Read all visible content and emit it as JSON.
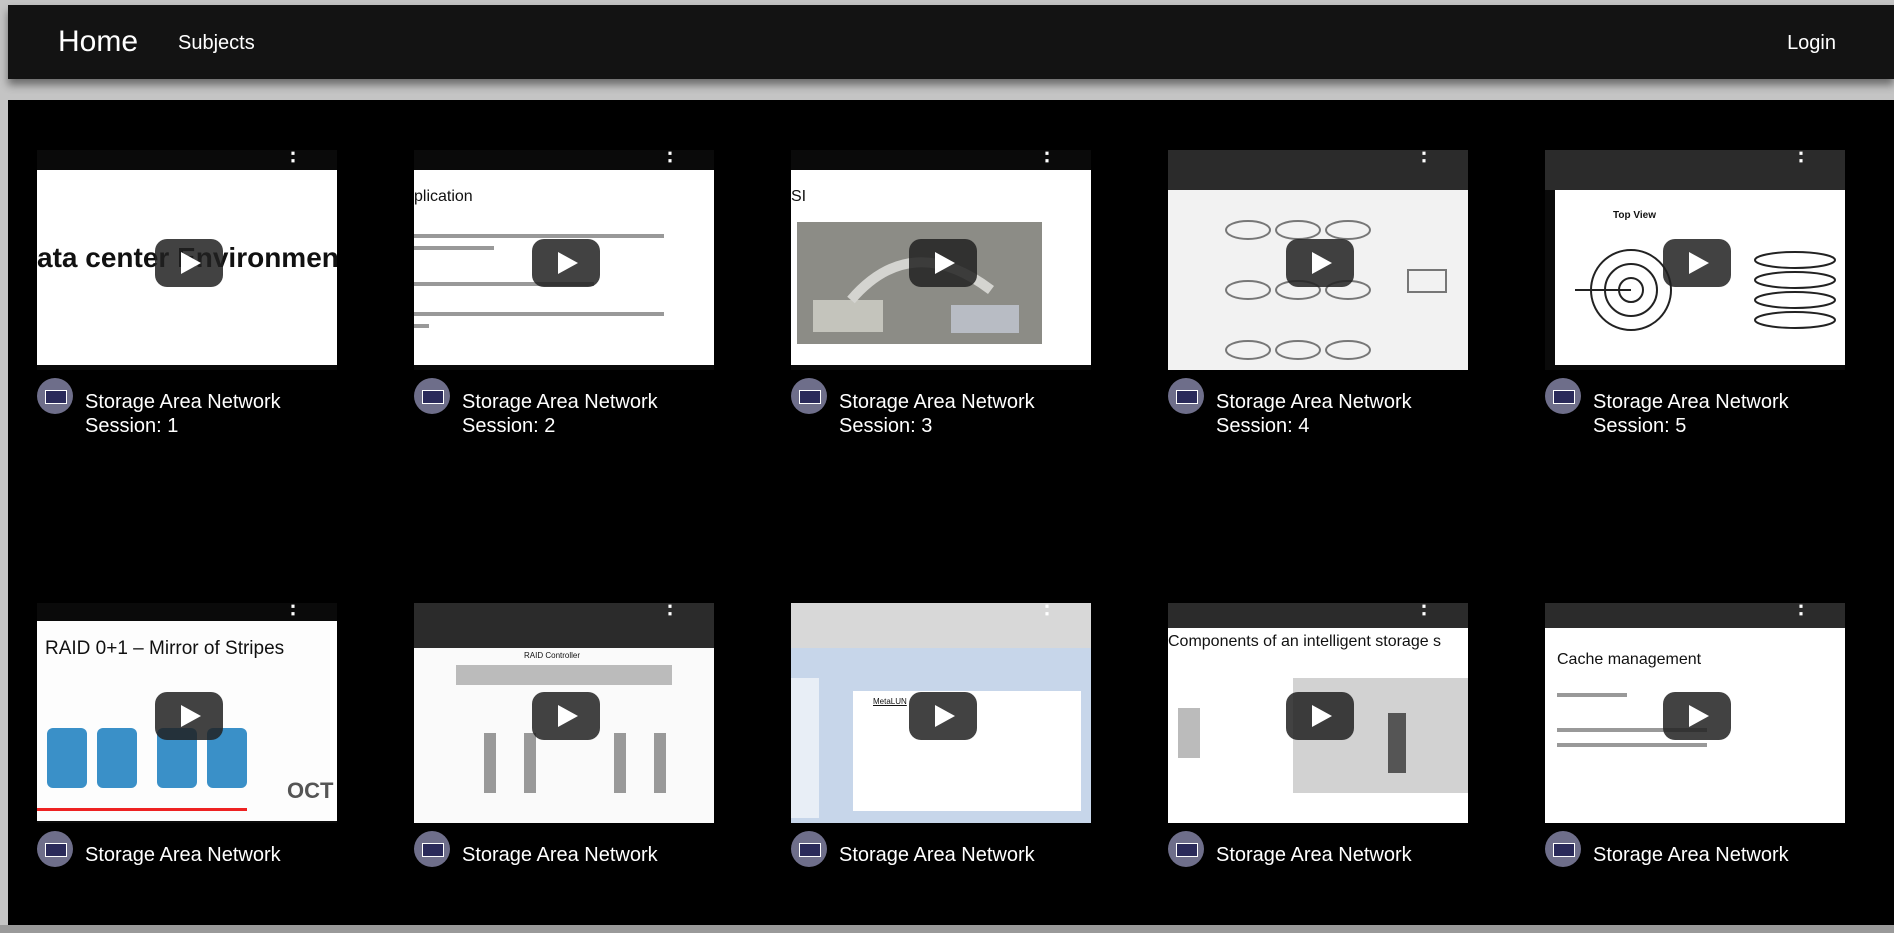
{
  "nav": {
    "home": "Home",
    "subjects": "Subjects",
    "login": "Login"
  },
  "cards": [
    {
      "title": "Storage Area Network",
      "session": "Session: 1",
      "slide": "ata center Environment"
    },
    {
      "title": "Storage Area Network",
      "session": "Session: 2",
      "slide": "plication"
    },
    {
      "title": "Storage Area Network",
      "session": "Session: 3",
      "slide": "SI"
    },
    {
      "title": "Storage Area Network",
      "session": "Session: 4",
      "slide": ""
    },
    {
      "title": "Storage Area Network",
      "session": "Session: 5",
      "slide": "Top View"
    },
    {
      "title": "Storage Area Network",
      "session": "",
      "slide": "RAID 0+1 – Mirror of Stripes"
    },
    {
      "title": "Storage Area Network",
      "session": "",
      "slide": "RAID Controller"
    },
    {
      "title": "Storage Area Network",
      "session": "",
      "slide": "MetaLUN"
    },
    {
      "title": "Storage Area Network",
      "session": "",
      "slide": "Components of an intelligent storage s"
    },
    {
      "title": "Storage Area Network",
      "session": "",
      "slide": "Cache management"
    }
  ]
}
